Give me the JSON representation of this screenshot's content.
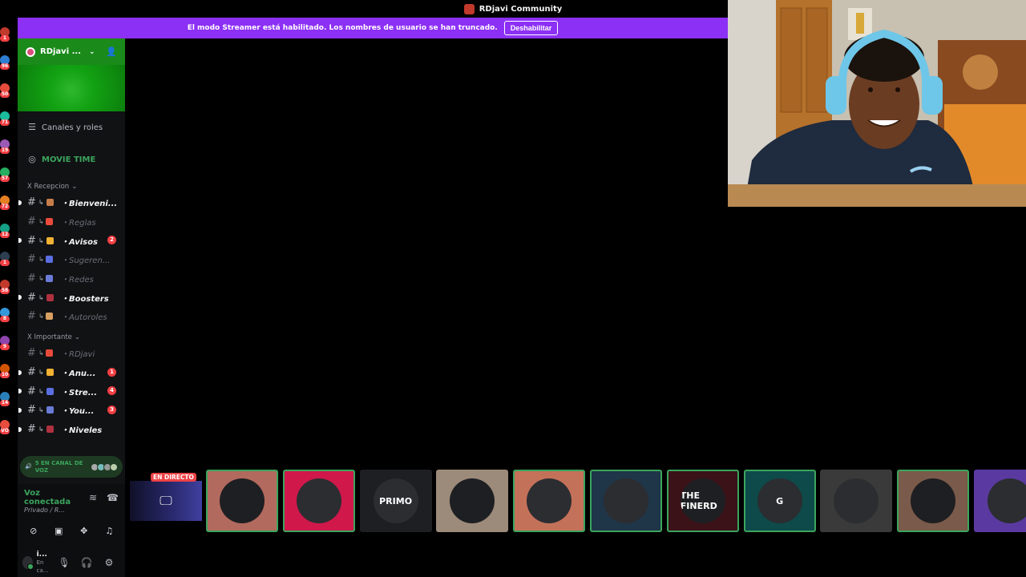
{
  "window": {
    "title": "RDjavi Community"
  },
  "streamer_banner": {
    "text": "El modo Streamer está habilitado. Los nombres de usuario se han truncado.",
    "button_label": "Deshabilitar"
  },
  "server": {
    "name": "RDjavi ..."
  },
  "nav": {
    "channels_roles": "Canales y roles",
    "event": "MOVIE TIME"
  },
  "categories": {
    "recepcion": "X Recepcion",
    "importante": "X Importante"
  },
  "channels_recepcion": [
    {
      "name": "・Bienveni...",
      "unread": true,
      "badge": ""
    },
    {
      "name": "・Reglas",
      "unread": false,
      "badge": ""
    },
    {
      "name": "・Avisos",
      "unread": true,
      "badge": "2"
    },
    {
      "name": "・Sugeren...",
      "unread": false,
      "badge": ""
    },
    {
      "name": "・Redes",
      "unread": false,
      "badge": ""
    },
    {
      "name": "・Boosters",
      "unread": true,
      "badge": ""
    },
    {
      "name": "・Autoroles",
      "unread": false,
      "badge": ""
    }
  ],
  "channels_importante": [
    {
      "name": "・RDjavi",
      "unread": false,
      "badge": ""
    },
    {
      "name": "・Anu...",
      "unread": true,
      "badge": "1"
    },
    {
      "name": "・Stre...",
      "unread": true,
      "badge": "4"
    },
    {
      "name": "・You...",
      "unread": true,
      "badge": "3"
    },
    {
      "name": "・Niveles",
      "unread": true,
      "badge": ""
    }
  ],
  "voice_pill": {
    "text_line1": "5 EN CANAL DE",
    "text_line2": "VOZ"
  },
  "voice_connection": {
    "status": "Voz conectada",
    "channel": "Privado / R..."
  },
  "user": {
    "name": "i...",
    "status": "En ca..."
  },
  "rail_badges": [
    "1",
    "96",
    "50",
    "71",
    "19",
    "57",
    "72",
    "12",
    "1",
    "58",
    "8",
    "9",
    "10",
    "14",
    "VO"
  ],
  "stream": {
    "live_label": "EN DIRECTO",
    "participants": [
      {
        "label": "",
        "bg": "#b36a5e",
        "speaking": true
      },
      {
        "label": "",
        "bg": "#d0184b",
        "speaking": true
      },
      {
        "label": "PRIMO",
        "bg": "#1e1f22",
        "speaking": false
      },
      {
        "label": "",
        "bg": "#9c8a7a",
        "speaking": false
      },
      {
        "label": "",
        "bg": "#c4715a",
        "speaking": true
      },
      {
        "label": "",
        "bg": "#1f3548",
        "speaking": true
      },
      {
        "label": "THE FINERD",
        "bg": "#3a1218",
        "speaking": true
      },
      {
        "label": "G",
        "bg": "#0e4a4a",
        "speaking": true
      },
      {
        "label": "",
        "bg": "#3a3a3a",
        "speaking": false
      },
      {
        "label": "",
        "bg": "#7a5a4a",
        "speaking": true
      },
      {
        "label": "",
        "bg": "#5a3aa0",
        "speaking": false
      }
    ]
  },
  "colors": {
    "banner": "#8c30f5",
    "online": "#3ba55d",
    "mention": "#f23f43"
  }
}
